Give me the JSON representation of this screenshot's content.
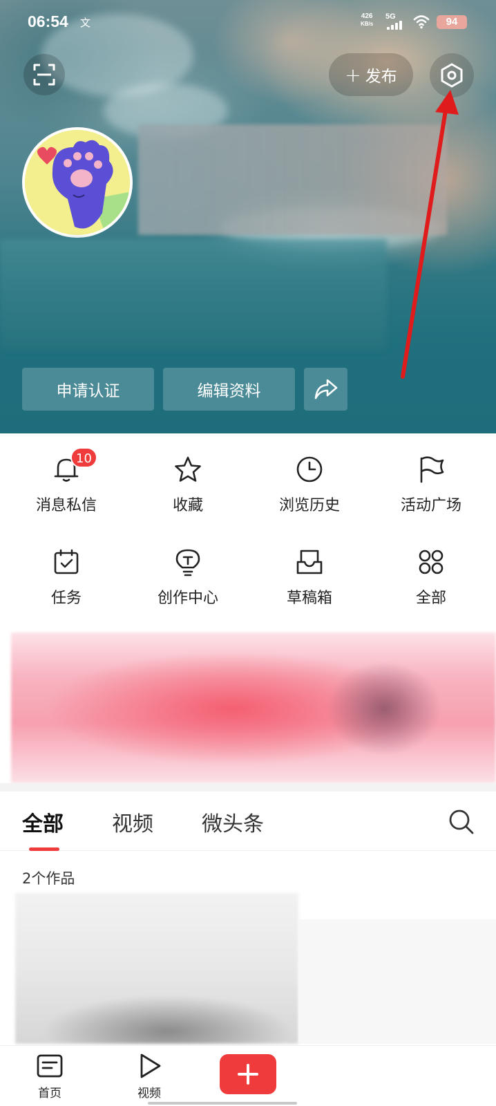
{
  "status_bar": {
    "time": "06:54",
    "notification_glyph": "文",
    "network_speed_value": "426",
    "network_speed_unit": "KB/s",
    "network_type": "5G",
    "battery": "94"
  },
  "header": {
    "publish_label": "发布",
    "actions": {
      "verify": "申请认证",
      "edit_profile": "编辑资料"
    }
  },
  "grid": {
    "items": [
      {
        "label": "消息私信",
        "icon": "bell-icon",
        "badge": "10"
      },
      {
        "label": "收藏",
        "icon": "star-icon"
      },
      {
        "label": "浏览历史",
        "icon": "clock-icon"
      },
      {
        "label": "活动广场",
        "icon": "flag-icon"
      },
      {
        "label": "任务",
        "icon": "calendar-check-icon"
      },
      {
        "label": "创作中心",
        "icon": "lightbulb-icon"
      },
      {
        "label": "草稿箱",
        "icon": "inbox-icon"
      },
      {
        "label": "全部",
        "icon": "four-circles-icon"
      }
    ]
  },
  "tabs": {
    "items": [
      "全部",
      "视频",
      "微头条"
    ],
    "selected": "全部"
  },
  "works_count": "2个作品",
  "bottom_nav": {
    "items": [
      {
        "label": "首页",
        "icon": "home-doc-icon"
      },
      {
        "label": "视频",
        "icon": "play-icon"
      }
    ]
  },
  "colors": {
    "accent": "#ef3b3b",
    "header_teal": "#1e6d7c",
    "annotation_arrow": "#e01b1b"
  }
}
